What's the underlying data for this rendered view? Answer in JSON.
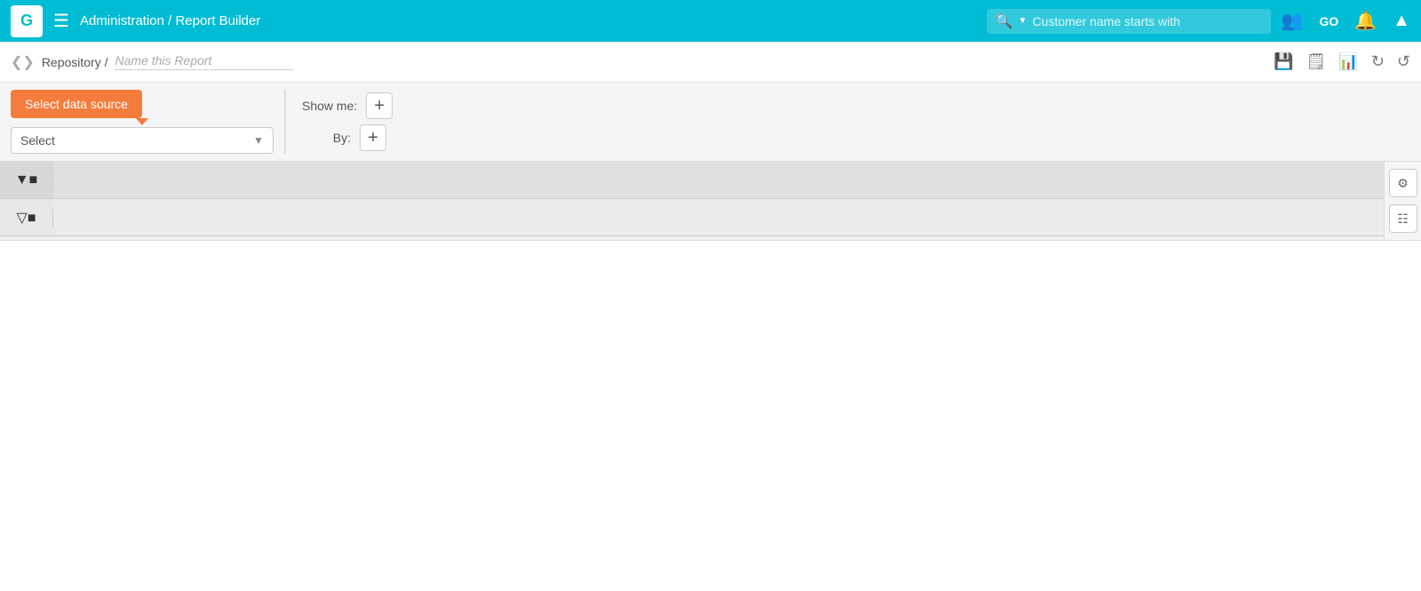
{
  "topbar": {
    "logo": "G",
    "breadcrumb": "Administration / Report Builder",
    "search_placeholder": "Customer name starts with",
    "icons": [
      "users-icon",
      "go-icon",
      "bell-icon",
      "expand-icon"
    ]
  },
  "subheader": {
    "breadcrumb": "Repository /",
    "report_name_placeholder": "Name this Report",
    "action_icons": [
      "save-icon",
      "save-as-icon",
      "chart-icon",
      "undo-icon",
      "redo-icon"
    ]
  },
  "toolbar": {
    "select_datasource_label": "Select data source",
    "select_label": "Select",
    "show_me_label": "Show me:",
    "by_label": "By:",
    "add_label": "+"
  },
  "table": {
    "filter_icon_unicode": "⊽",
    "settings_icon_unicode": "⚙",
    "grid_icon_unicode": "⊞"
  }
}
